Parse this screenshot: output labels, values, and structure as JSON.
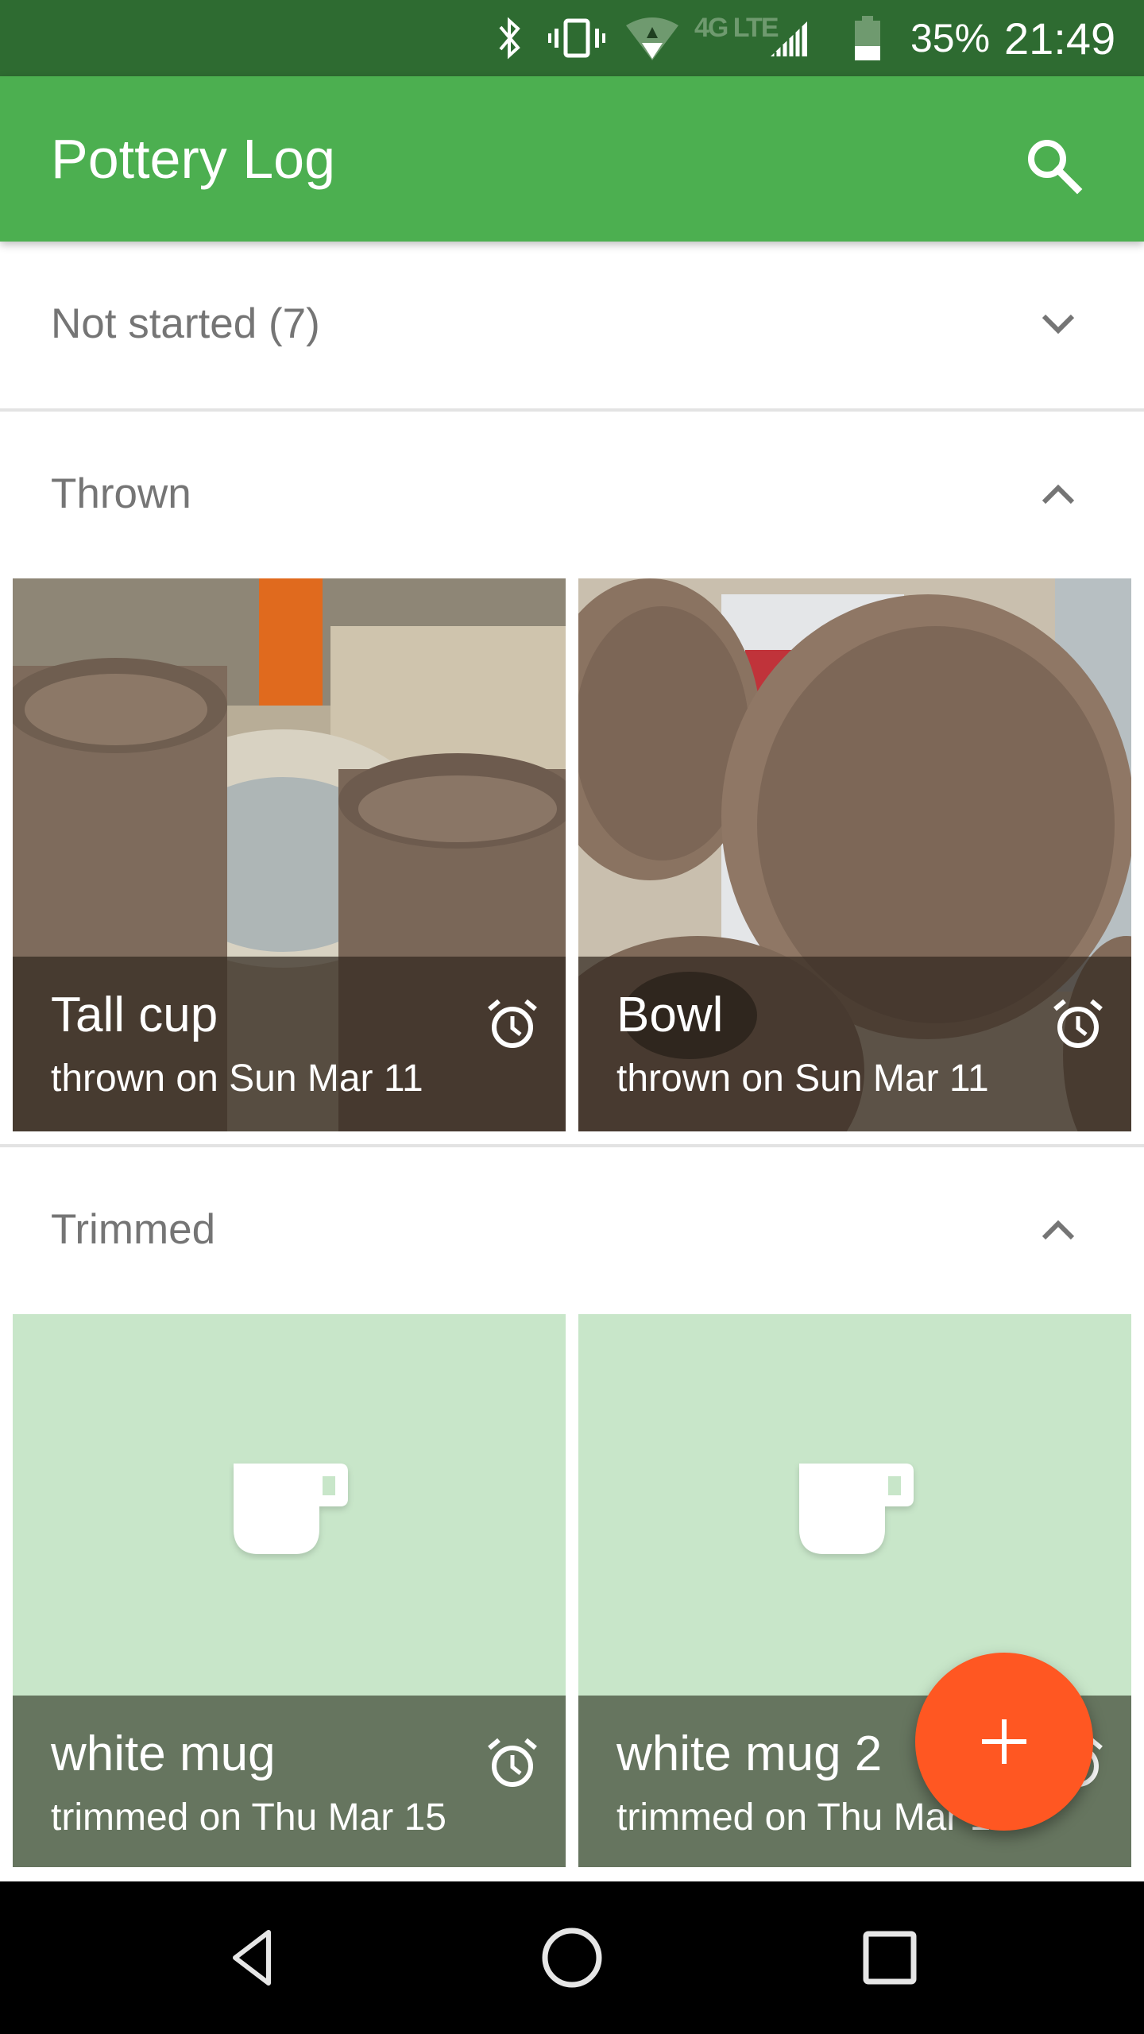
{
  "status_bar": {
    "icons": [
      "bluetooth-icon",
      "vibrate-icon",
      "wifi-icon",
      "lte-icon",
      "signal-icon",
      "battery-icon"
    ],
    "network_label": "4G LTE",
    "battery_percent": "35%",
    "battery_level": 0.35,
    "time": "21:49"
  },
  "app_bar": {
    "title": "Pottery Log",
    "search_icon": "search-icon"
  },
  "sections": [
    {
      "title": "Not started (7)",
      "expanded": false,
      "chevron": "chevron-down-icon",
      "items": []
    },
    {
      "title": "Thrown",
      "expanded": true,
      "chevron": "chevron-up-icon",
      "items": [
        {
          "name": "Tall cup",
          "subtitle": "thrown on Sun Mar 11",
          "image": "photo-tall-cups",
          "alarm_icon": "alarm-icon"
        },
        {
          "name": "Bowl",
          "subtitle": "thrown on Sun Mar 11",
          "image": "photo-bowls",
          "alarm_icon": "alarm-icon"
        }
      ]
    },
    {
      "title": "Trimmed",
      "expanded": true,
      "chevron": "chevron-up-icon",
      "items": [
        {
          "name": "white mug",
          "subtitle": "trimmed on Thu Mar 15",
          "image": "mug-placeholder-icon",
          "alarm_icon": "alarm-icon"
        },
        {
          "name": "white mug 2",
          "subtitle": "trimmed on Thu Mar 15",
          "image": "mug-placeholder-icon",
          "alarm_icon": "alarm-icon"
        }
      ]
    }
  ],
  "fab": {
    "icon": "plus-icon",
    "label": "Add"
  },
  "nav_bar": {
    "buttons": [
      "back-icon",
      "home-icon",
      "recents-icon"
    ]
  },
  "colors": {
    "status_bar": "#2e6b31",
    "app_bar": "#4caf50",
    "section_text": "#757575",
    "placeholder_bg": "#c8e6c9",
    "placeholder_overlay": "#66755f",
    "fab": "#ff5722"
  }
}
